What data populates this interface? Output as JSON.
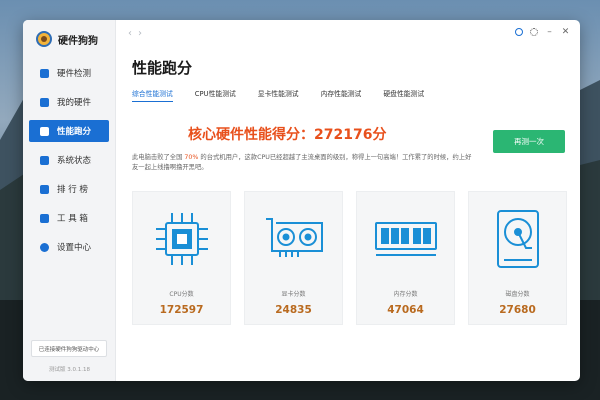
{
  "app": {
    "title": "硬件狗狗",
    "version": "测试版 3.0.1.18"
  },
  "sidebar": {
    "items": [
      {
        "label": "硬件检测",
        "icon": "hardware-detect-icon",
        "active": false
      },
      {
        "label": "我的硬件",
        "icon": "my-hardware-icon",
        "active": false
      },
      {
        "label": "性能跑分",
        "icon": "benchmark-icon",
        "active": true
      },
      {
        "label": "系统状态",
        "icon": "system-status-icon",
        "active": false
      },
      {
        "label": "排 行 榜",
        "icon": "ranking-icon",
        "active": false
      },
      {
        "label": "工 具 箱",
        "icon": "toolbox-icon",
        "active": false
      },
      {
        "label": "设置中心",
        "icon": "settings-icon",
        "active": false
      }
    ],
    "bottom_button": "已连接硬件狗狗驱动中心"
  },
  "page": {
    "title": "性能跑分",
    "tabs": [
      {
        "label": "综合性能测试",
        "active": true
      },
      {
        "label": "CPU性能测试",
        "active": false
      },
      {
        "label": "显卡性能测试",
        "active": false
      },
      {
        "label": "内存性能测试",
        "active": false
      },
      {
        "label": "硬盘性能测试",
        "active": false
      }
    ],
    "score_text": "核心硬件性能得分：272176分",
    "retest_label": "再测一次",
    "desc_pre": "此电脑击败了全国 ",
    "desc_percent": "70%",
    "desc_post": " 的台式机用户，这款CPU已经超越了主流桌面的级别，称得上一句高端！工作累了的时候，约上好友一起上线撸啊撸开黑吧。"
  },
  "cards": [
    {
      "icon": "cpu-chip-icon",
      "label": "CPU分数",
      "value": "172597"
    },
    {
      "icon": "graphics-card-icon",
      "label": "显卡分数",
      "value": "24835"
    },
    {
      "icon": "memory-module-icon",
      "label": "内存分数",
      "value": "47064"
    },
    {
      "icon": "hard-disk-icon",
      "label": "磁盘分数",
      "value": "27680"
    }
  ],
  "colors": {
    "accent": "#1a6fd3",
    "score": "#e8501c",
    "button": "#2bb673",
    "value": "#b96a1f"
  }
}
